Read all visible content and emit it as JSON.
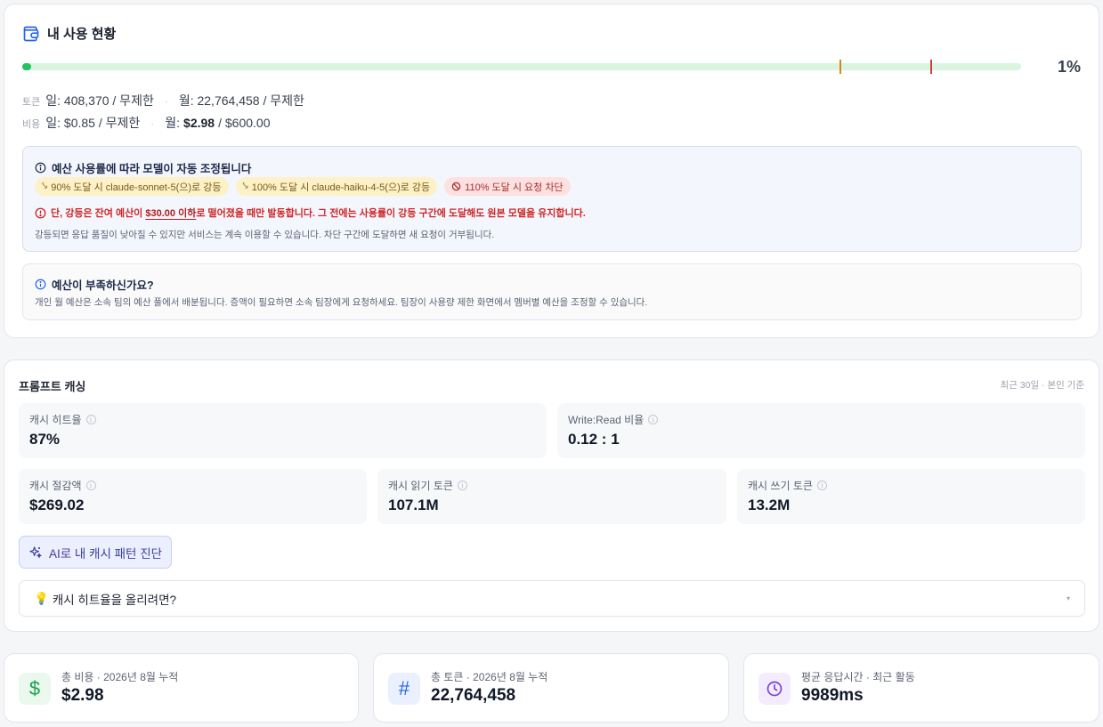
{
  "usage": {
    "title": "내 사용 현황",
    "progress_fraction": 0.01,
    "percent_label": "1%",
    "threshold_markers": [
      0.9,
      1.0
    ],
    "tokens": {
      "tag": "토큰",
      "daily": "일: 408,370 / 무제한",
      "monthly": "월: 22,764,458 / 무제한"
    },
    "cost": {
      "tag": "비용",
      "daily": "일: $0.85 / 무제한",
      "monthly_prefix": "월:",
      "monthly_used": "$2.98",
      "monthly_suffix": "/ $600.00"
    },
    "budget_info": {
      "title": "예산 사용률에 따라 모델이 자동 조정됩니다",
      "chips": [
        "90% 도달 시 claude-sonnet-5(으)로 강등",
        "100% 도달 시 claude-haiku-4-5(으)로 강등",
        "110% 도달 시 요청 차단"
      ],
      "warning_prefix": "단, 강등은 잔여 예산이",
      "warning_highlight": "$30.00 이하",
      "warning_suffix": "로 떨어졌을 때만 발동합니다. 그 전에는 사용률이 강등 구간에 도달해도 원본 모델을 유지합니다.",
      "note": "강등되면 응답 품질이 낮아질 수 있지만 서비스는 계속 이용할 수 있습니다. 차단 구간에 도달하면 새 요청이 거부됩니다."
    },
    "shortage_info": {
      "title": "예산이 부족하신가요?",
      "note": "개인 월 예산은 소속 팀의 예산 풀에서 배분됩니다. 증액이 필요하면 소속 팀장에게 요청하세요. 팀장이 사용량 제한 화면에서 멤버별 예산을 조정할 수 있습니다."
    }
  },
  "caching": {
    "title": "프롬프트 캐싱",
    "meta": "최근 30일 · 본인 기준",
    "metrics": [
      {
        "label": "캐시 히트율",
        "value": "87%"
      },
      {
        "label": "Write:Read 비율",
        "value": "0.12 : 1"
      },
      {
        "label": "캐시 절감액",
        "value": "$269.02"
      },
      {
        "label": "캐시 읽기 토큰",
        "value": "107.1M"
      },
      {
        "label": "캐시 쓰기 토큰",
        "value": "13.2M"
      }
    ],
    "ai_button": "AI로 내 캐시 패턴 진단",
    "accordion_icon": "💡",
    "accordion_label": "캐시 히트율을 올리려면?",
    "accordion_chevron": "▾"
  },
  "stats": [
    {
      "icon": "dollar-icon",
      "symbol": "$",
      "label": "총 비용 · 2026년 8월 누적",
      "value": "$2.98",
      "color": "#16a34a",
      "bg": "#eaf8ee"
    },
    {
      "icon": "hash-icon",
      "symbol": "#",
      "label": "총 토큰 · 2026년 8월 누적",
      "value": "22,764,458",
      "color": "#2563eb",
      "bg": "#eaf0fd"
    },
    {
      "icon": "clock-icon",
      "symbol": "",
      "label": "평균 응답시간 · 최근 활동",
      "value": "9989ms",
      "color": "#7e3fd4",
      "bg": "#f3ecfd"
    }
  ],
  "colors": {
    "accent": "#2563eb",
    "progress_fill": "#22c55e",
    "progress_track": "#d9f5e0",
    "marker_warn": "#d08a18",
    "marker_block": "#d33a3a",
    "danger": "#d02626"
  }
}
